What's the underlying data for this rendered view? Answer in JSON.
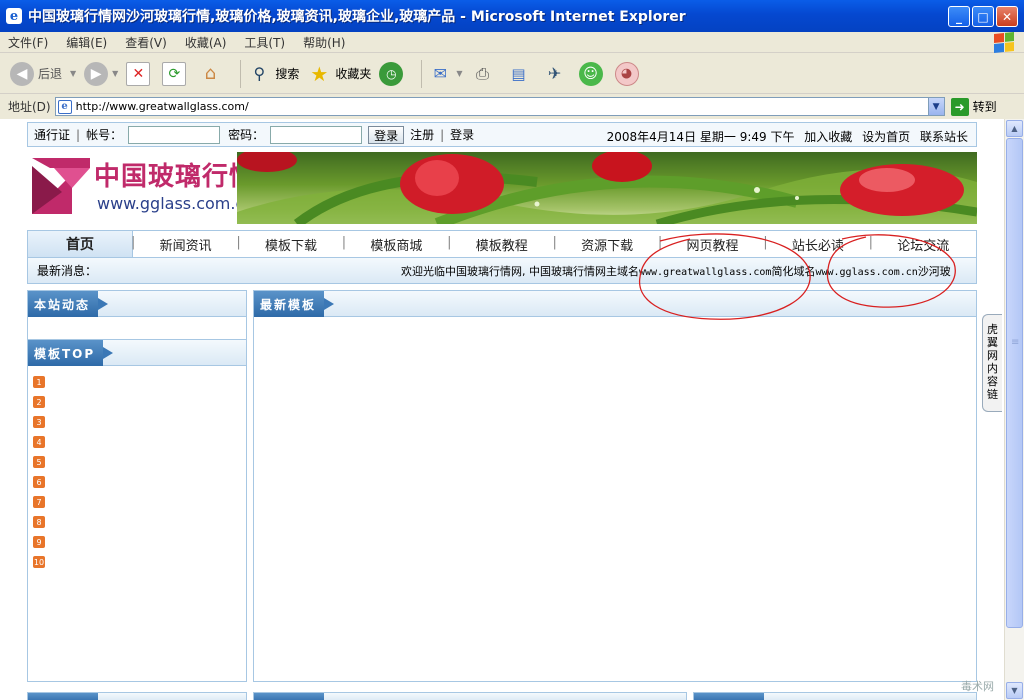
{
  "window": {
    "title": "中国玻璃行情网沙河玻璃行情,玻璃价格,玻璃资讯,玻璃企业,玻璃产品 - Microsoft Internet Explorer",
    "buttons": {
      "minimize": "_",
      "maximize": "□",
      "close": "✕"
    }
  },
  "menu": [
    "文件(F)",
    "编辑(E)",
    "查看(V)",
    "收藏(A)",
    "工具(T)",
    "帮助(H)"
  ],
  "toolbar": {
    "back": "后退",
    "search": "搜索",
    "favorites": "收藏夹"
  },
  "address": {
    "label": "地址(D)",
    "url": "http://www.greatwallglass.com/",
    "go": "转到"
  },
  "login": {
    "passport": "通行证",
    "account_label": "帐号：",
    "password_label": "密码：",
    "login_button": "登录",
    "register": "注册",
    "login_link": "登录",
    "datetime": "2008年4月14日 星期一 9:49 下午",
    "add_favorite": "加入收藏",
    "set_home": "设为首页",
    "contact": "联系站长"
  },
  "logo": {
    "cn": "中国玻璃行情网",
    "en": "www.gglass.com.cn"
  },
  "nav": {
    "home": "首页",
    "items": [
      "新闻资讯",
      "模板下载",
      "模板商城",
      "模板教程",
      "资源下载",
      "网页教程",
      "站长必读",
      "论坛交流"
    ]
  },
  "news": {
    "label": "最新消息：",
    "text_a": "欢迎光临中国玻璃行情网, 中国玻璃行情网主域名",
    "domain_main": "www.greatwallglass.com",
    "text_b": "简化域名",
    "domain_short": "www.gglass.com.cn",
    "text_c": "沙河玻"
  },
  "panels": {
    "site_news": "本站动态",
    "template_top": "模板TOP",
    "latest_templates": "最新模板",
    "top_numbers": [
      "1",
      "2",
      "3",
      "4",
      "5",
      "6",
      "7",
      "8",
      "9",
      "10"
    ]
  },
  "side_tab": "虎翼网 内容链",
  "watermark": "毒术网",
  "colors": {
    "title_bar": "#0548d0",
    "panel_tab": "#2e6aa8",
    "panel_border": "#a7c7e3",
    "rank_badge": "#e8752a",
    "annotation": "#d82020"
  }
}
